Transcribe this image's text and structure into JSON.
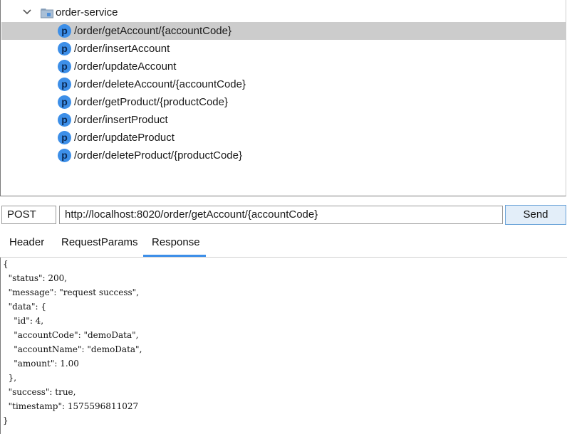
{
  "tree": {
    "root_label": "order-service",
    "badge_letter": "p",
    "items": [
      {
        "label": "/order/getAccount/{accountCode}",
        "selected": true
      },
      {
        "label": "/order/insertAccount",
        "selected": false
      },
      {
        "label": "/order/updateAccount",
        "selected": false
      },
      {
        "label": "/order/deleteAccount/{accountCode}",
        "selected": false
      },
      {
        "label": "/order/getProduct/{productCode}",
        "selected": false
      },
      {
        "label": "/order/insertProduct",
        "selected": false
      },
      {
        "label": "/order/updateProduct",
        "selected": false
      },
      {
        "label": "/order/deleteProduct/{productCode}",
        "selected": false
      }
    ]
  },
  "request": {
    "method": "POST",
    "url": "http://localhost:8020/order/getAccount/{accountCode}",
    "send_label": "Send"
  },
  "tabs": [
    {
      "label": "Header",
      "active": false
    },
    {
      "label": "RequestParams",
      "active": false
    },
    {
      "label": "Response",
      "active": true
    }
  ],
  "response_lines": [
    "{",
    "  \"status\": 200,",
    "  \"message\": \"request success\",",
    "  \"data\": {",
    "    \"id\": 4,",
    "    \"accountCode\": \"demoData\",",
    "    \"accountName\": \"demoData\",",
    "    \"amount\": 1.00",
    "  },",
    "  \"success\": true,",
    "  \"timestamp\": 1575596811027",
    "}"
  ],
  "colors": {
    "accent": "#3d8fe8",
    "selected_row": "#cccccc",
    "send_bg": "#e3eef9"
  },
  "icons": {
    "expand": "chevron-down-icon",
    "root": "folder-icon",
    "endpoint": "p-badge-icon"
  }
}
